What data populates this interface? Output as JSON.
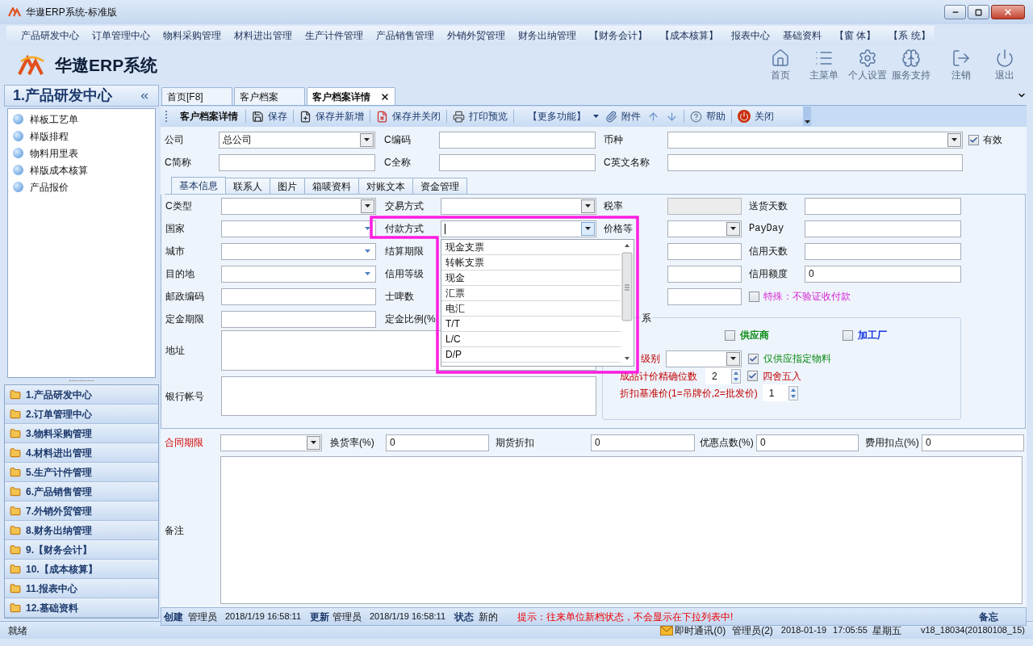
{
  "window": {
    "title": "华遨ERP系统-标准版"
  },
  "menu": [
    "产品研发中心",
    "订单管理中心",
    "物料采购管理",
    "材料进出管理",
    "生产计件管理",
    "产品销售管理",
    "外销外贸管理",
    "财务出纳管理",
    "【财务会计】",
    "【成本核算】",
    "报表中心",
    "基础资料",
    "【窗 体】",
    "【系 统】"
  ],
  "app": {
    "name": "华遨ERP系统"
  },
  "quick_actions": [
    {
      "kind": "home",
      "label": "首页"
    },
    {
      "kind": "menu",
      "label": "主菜单"
    },
    {
      "kind": "settings",
      "label": "个人设置"
    },
    {
      "kind": "support",
      "label": "服务支持"
    },
    {
      "kind": "logout",
      "label": "注销"
    },
    {
      "kind": "exit",
      "label": "退出"
    }
  ],
  "sidebar": {
    "title": "1.产品研发中心",
    "items": [
      "样板工艺单",
      "样版排程",
      "物料用里表",
      "样版成本核算",
      "产品报价"
    ],
    "modules": [
      "1.产品研发中心",
      "2.订单管理中心",
      "3.物料采购管理",
      "4.材料进出管理",
      "5.生产计件管理",
      "6.产品销售管理",
      "7.外销外贸管理",
      "8.财务出纳管理",
      "9.【财务会计】",
      "10.【成本核算】",
      "11.报表中心",
      "12.基础资料"
    ]
  },
  "tabs": [
    {
      "label": "首页[F8]",
      "selected": false,
      "closable": false
    },
    {
      "label": "客户档案",
      "selected": false,
      "closable": false
    },
    {
      "label": "客户档案详情",
      "selected": true,
      "closable": true
    }
  ],
  "toolbar": {
    "title": "客户档案详情",
    "buttons": [
      {
        "kind": "save",
        "label": "保存"
      },
      {
        "kind": "savenew",
        "label": "保存并新增"
      },
      {
        "kind": "saveclose",
        "label": "保存并关闭"
      },
      {
        "kind": "print",
        "label": "打印预览"
      },
      {
        "kind": "more",
        "label": "【更多功能】"
      },
      {
        "kind": "attach",
        "label": "附件"
      },
      {
        "kind": "up"
      },
      {
        "kind": "down"
      },
      {
        "kind": "help",
        "label": "帮助"
      },
      {
        "kind": "close",
        "label": "关闭"
      }
    ]
  },
  "header_fields": [
    [
      {
        "label": "公司",
        "kind": "select",
        "value": "总公司"
      },
      {
        "label": "C编码",
        "kind": "text"
      },
      {
        "label": "币种",
        "kind": "select"
      }
    ],
    [
      {
        "label": "C简称",
        "kind": "text"
      },
      {
        "label": "C全称",
        "kind": "text"
      },
      {
        "label": "C英文名称",
        "kind": "text"
      }
    ]
  ],
  "valid": {
    "label": "有效",
    "checked": true
  },
  "subtabs": [
    {
      "label": "基本信息",
      "selected": true
    },
    {
      "label": "联系人",
      "selected": false
    },
    {
      "label": "图片",
      "selected": false
    },
    {
      "label": "箱唛资料",
      "selected": false
    },
    {
      "label": "对账文本",
      "selected": false
    },
    {
      "label": "资金管理",
      "selected": false
    }
  ],
  "basic_rows": [
    [
      {
        "label": "C类型",
        "kind": "select"
      },
      {
        "label": "交易方式",
        "kind": "select"
      },
      {
        "label": "税率",
        "kind": "readonly"
      },
      {
        "label": "送货天数",
        "kind": "text"
      }
    ],
    [
      {
        "label": "国家",
        "kind": "combo"
      },
      {
        "label": "付款方式",
        "kind": "select",
        "open": true,
        "options": [
          "现金支票",
          "转帐支票",
          "现金",
          "汇票",
          "电汇",
          "T/T",
          "L/C",
          "D/P"
        ]
      },
      {
        "label": "价格等",
        "kind": "select"
      },
      {
        "label": "PayDay",
        "kind": "text"
      }
    ],
    [
      {
        "label": "城市",
        "kind": "combo"
      },
      {
        "label": "结算期限",
        "kind": "text"
      },
      {
        "kind": "text"
      },
      {
        "label": "信用天数",
        "kind": "text"
      }
    ],
    [
      {
        "label": "目的地",
        "kind": "combo"
      },
      {
        "label": "信用等级",
        "kind": "text"
      },
      {
        "kind": "text"
      },
      {
        "label": "信用额度",
        "kind": "text",
        "value": "0"
      }
    ],
    [
      {
        "label": "邮政编码",
        "kind": "text"
      },
      {
        "label": "士啤数",
        "kind": "text"
      },
      {
        "kind": "text"
      },
      {
        "label": "特殊：不验证收付款",
        "kind": "check",
        "checked": false
      }
    ]
  ],
  "deposit_row": [
    {
      "label": "定金期限",
      "kind": "text"
    },
    {
      "label": "定金比例(%",
      "kind": "text"
    }
  ],
  "address": {
    "label": "地址"
  },
  "bank": {
    "label": "银行帐号"
  },
  "relation": {
    "legend": "系",
    "supplier": {
      "label": "供应商",
      "checked": false
    },
    "factory": {
      "label": "加工厂",
      "checked": false
    },
    "grade": {
      "label": "级别"
    },
    "only_material": {
      "label": "仅供应指定物料",
      "checked": true
    },
    "precision": {
      "label": "成品计价精确位数",
      "value": "2"
    },
    "rounding": {
      "label": "四舍五入",
      "checked": true
    },
    "discount_base": {
      "label": "折扣基准价(1=吊牌价,2=批发价)",
      "value": "1"
    }
  },
  "contract_fields": [
    {
      "label": "合同期限",
      "kind": "select",
      "required": true
    },
    {
      "label": "换货率(%)",
      "kind": "text",
      "value": "0",
      "required": false
    },
    {
      "label": "期货折扣",
      "kind": "text",
      "value": "0",
      "required": false
    },
    {
      "label": "优惠点数(%)",
      "kind": "text",
      "value": "0",
      "required": false
    },
    {
      "label": "费用扣点(%)",
      "kind": "text",
      "value": "0",
      "required": false
    }
  ],
  "remarks": {
    "label": "备注"
  },
  "record": {
    "created_label": "创建",
    "created_by": "管理员",
    "created_at": "2018/1/19 16:58:11",
    "updated_label": "更新",
    "updated_by": "管理员",
    "updated_at": "2018/1/19 16:58:11",
    "status_label": "状态",
    "status": "新的",
    "hint": "提示：往来单位新档状态，不会显示在下拉列表中!",
    "memo": "备忘"
  },
  "status_bar": {
    "state": "就绪",
    "im": "即时通讯(0)",
    "user": "管理员(2)",
    "date": "2018-01-19",
    "time": "17:05:55",
    "weekday": "星期五",
    "version": "v18_18034(20180108_15)"
  }
}
